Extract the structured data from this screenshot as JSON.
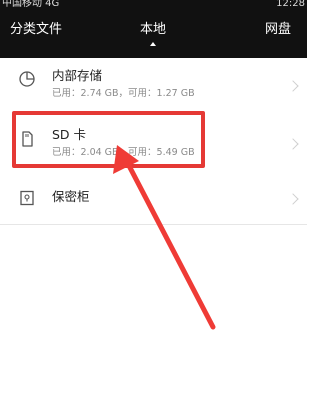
{
  "status_bar": {
    "carrier": "中国移动 4G",
    "time": "12:28"
  },
  "tabs": [
    {
      "label": "分类文件"
    },
    {
      "label": "本地"
    },
    {
      "label": "网盘"
    }
  ],
  "storage": {
    "internal": {
      "title": "内部存储",
      "usage": "已用：2.74 GB，可用：1.27 GB",
      "icon": "pie-chart-icon"
    },
    "sd": {
      "title": "SD 卡",
      "usage": "已用：2.04 GB，可用：5.49 GB",
      "icon": "sd-card-icon"
    },
    "safe": {
      "title": "保密柜",
      "icon": "safe-lock-icon"
    }
  },
  "colors": {
    "topbar": "#111111",
    "highlight": "#e53935",
    "background": "#ffffff"
  }
}
